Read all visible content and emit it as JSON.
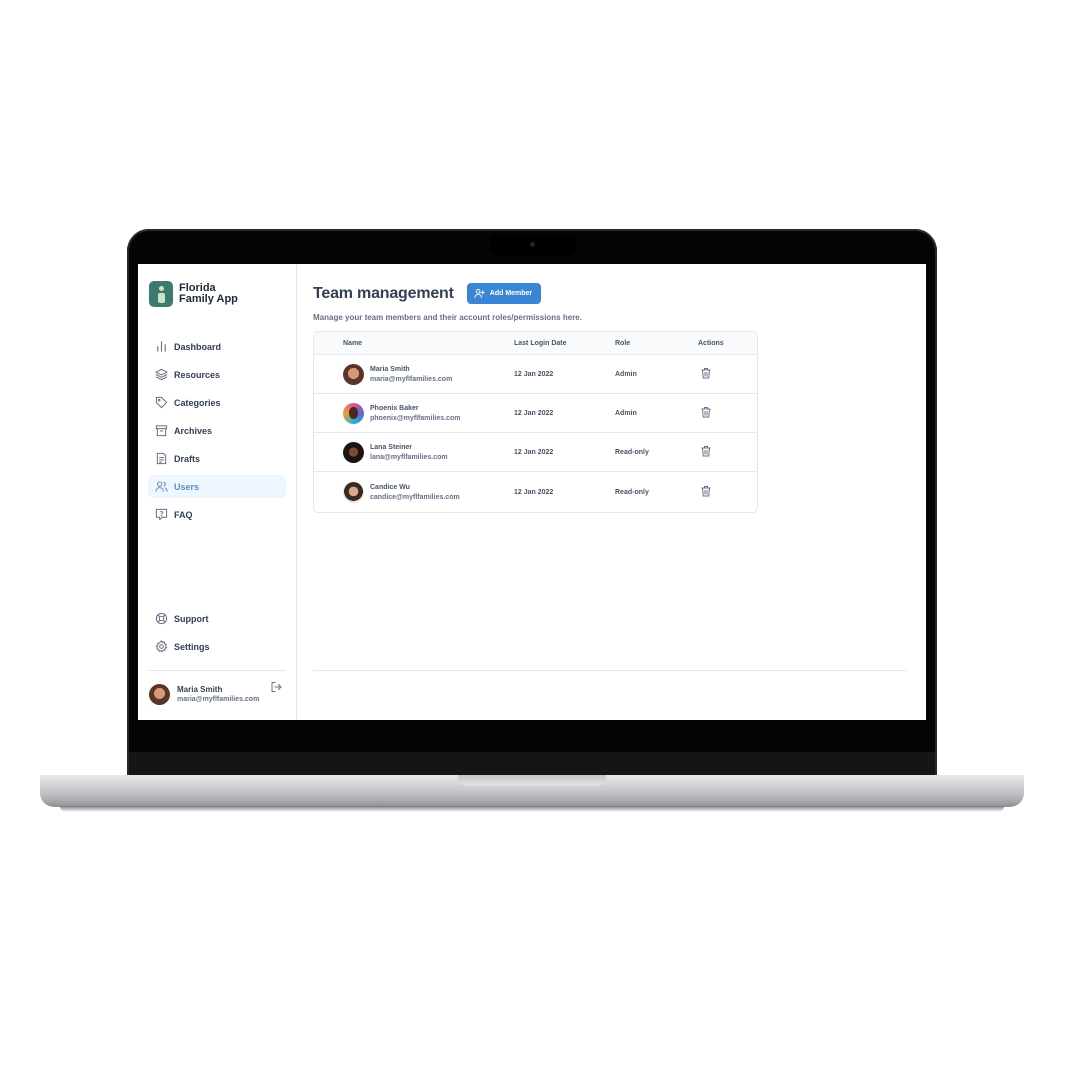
{
  "app": {
    "brand_name": "Florida Family App"
  },
  "sidebar": {
    "items": [
      {
        "label": "Dashboard",
        "icon": "bar-chart-icon"
      },
      {
        "label": "Resources",
        "icon": "layers-icon"
      },
      {
        "label": "Categories",
        "icon": "tag-icon"
      },
      {
        "label": "Archives",
        "icon": "archive-icon"
      },
      {
        "label": "Drafts",
        "icon": "drafts-icon"
      },
      {
        "label": "Users",
        "icon": "users-icon",
        "active": true
      },
      {
        "label": "FAQ",
        "icon": "faq-icon"
      }
    ],
    "bottom_items": [
      {
        "label": "Support",
        "icon": "lifebuoy-icon"
      },
      {
        "label": "Settings",
        "icon": "gear-icon"
      }
    ],
    "profile": {
      "name": "Maria Smith",
      "email": "maria@myflfamilies.com"
    }
  },
  "main": {
    "title": "Team management",
    "add_button": "Add Member",
    "subtitle": "Manage your team members and their account roles/permissions here.",
    "table": {
      "headers": [
        "Name",
        "Last Login Date",
        "Role",
        "Actions"
      ],
      "rows": [
        {
          "name": "Maria Smith",
          "email": "maria@myflfamilies.com",
          "last_login": "12 Jan 2022",
          "role": "Admin"
        },
        {
          "name": "Phoenix Baker",
          "email": "phoenix@myflfamilies.com",
          "last_login": "12 Jan 2022",
          "role": "Admin"
        },
        {
          "name": "Lana Steiner",
          "email": "lana@myflfamilies.com",
          "last_login": "12 Jan 2022",
          "role": "Read-only"
        },
        {
          "name": "Candice Wu",
          "email": "candice@myflfamilies.com",
          "last_login": "12 Jan 2022",
          "role": "Read-only"
        }
      ]
    }
  },
  "colors": {
    "accent": "#3a86d4",
    "active_bg": "#eef6ff",
    "brand": "#3f7a71"
  }
}
